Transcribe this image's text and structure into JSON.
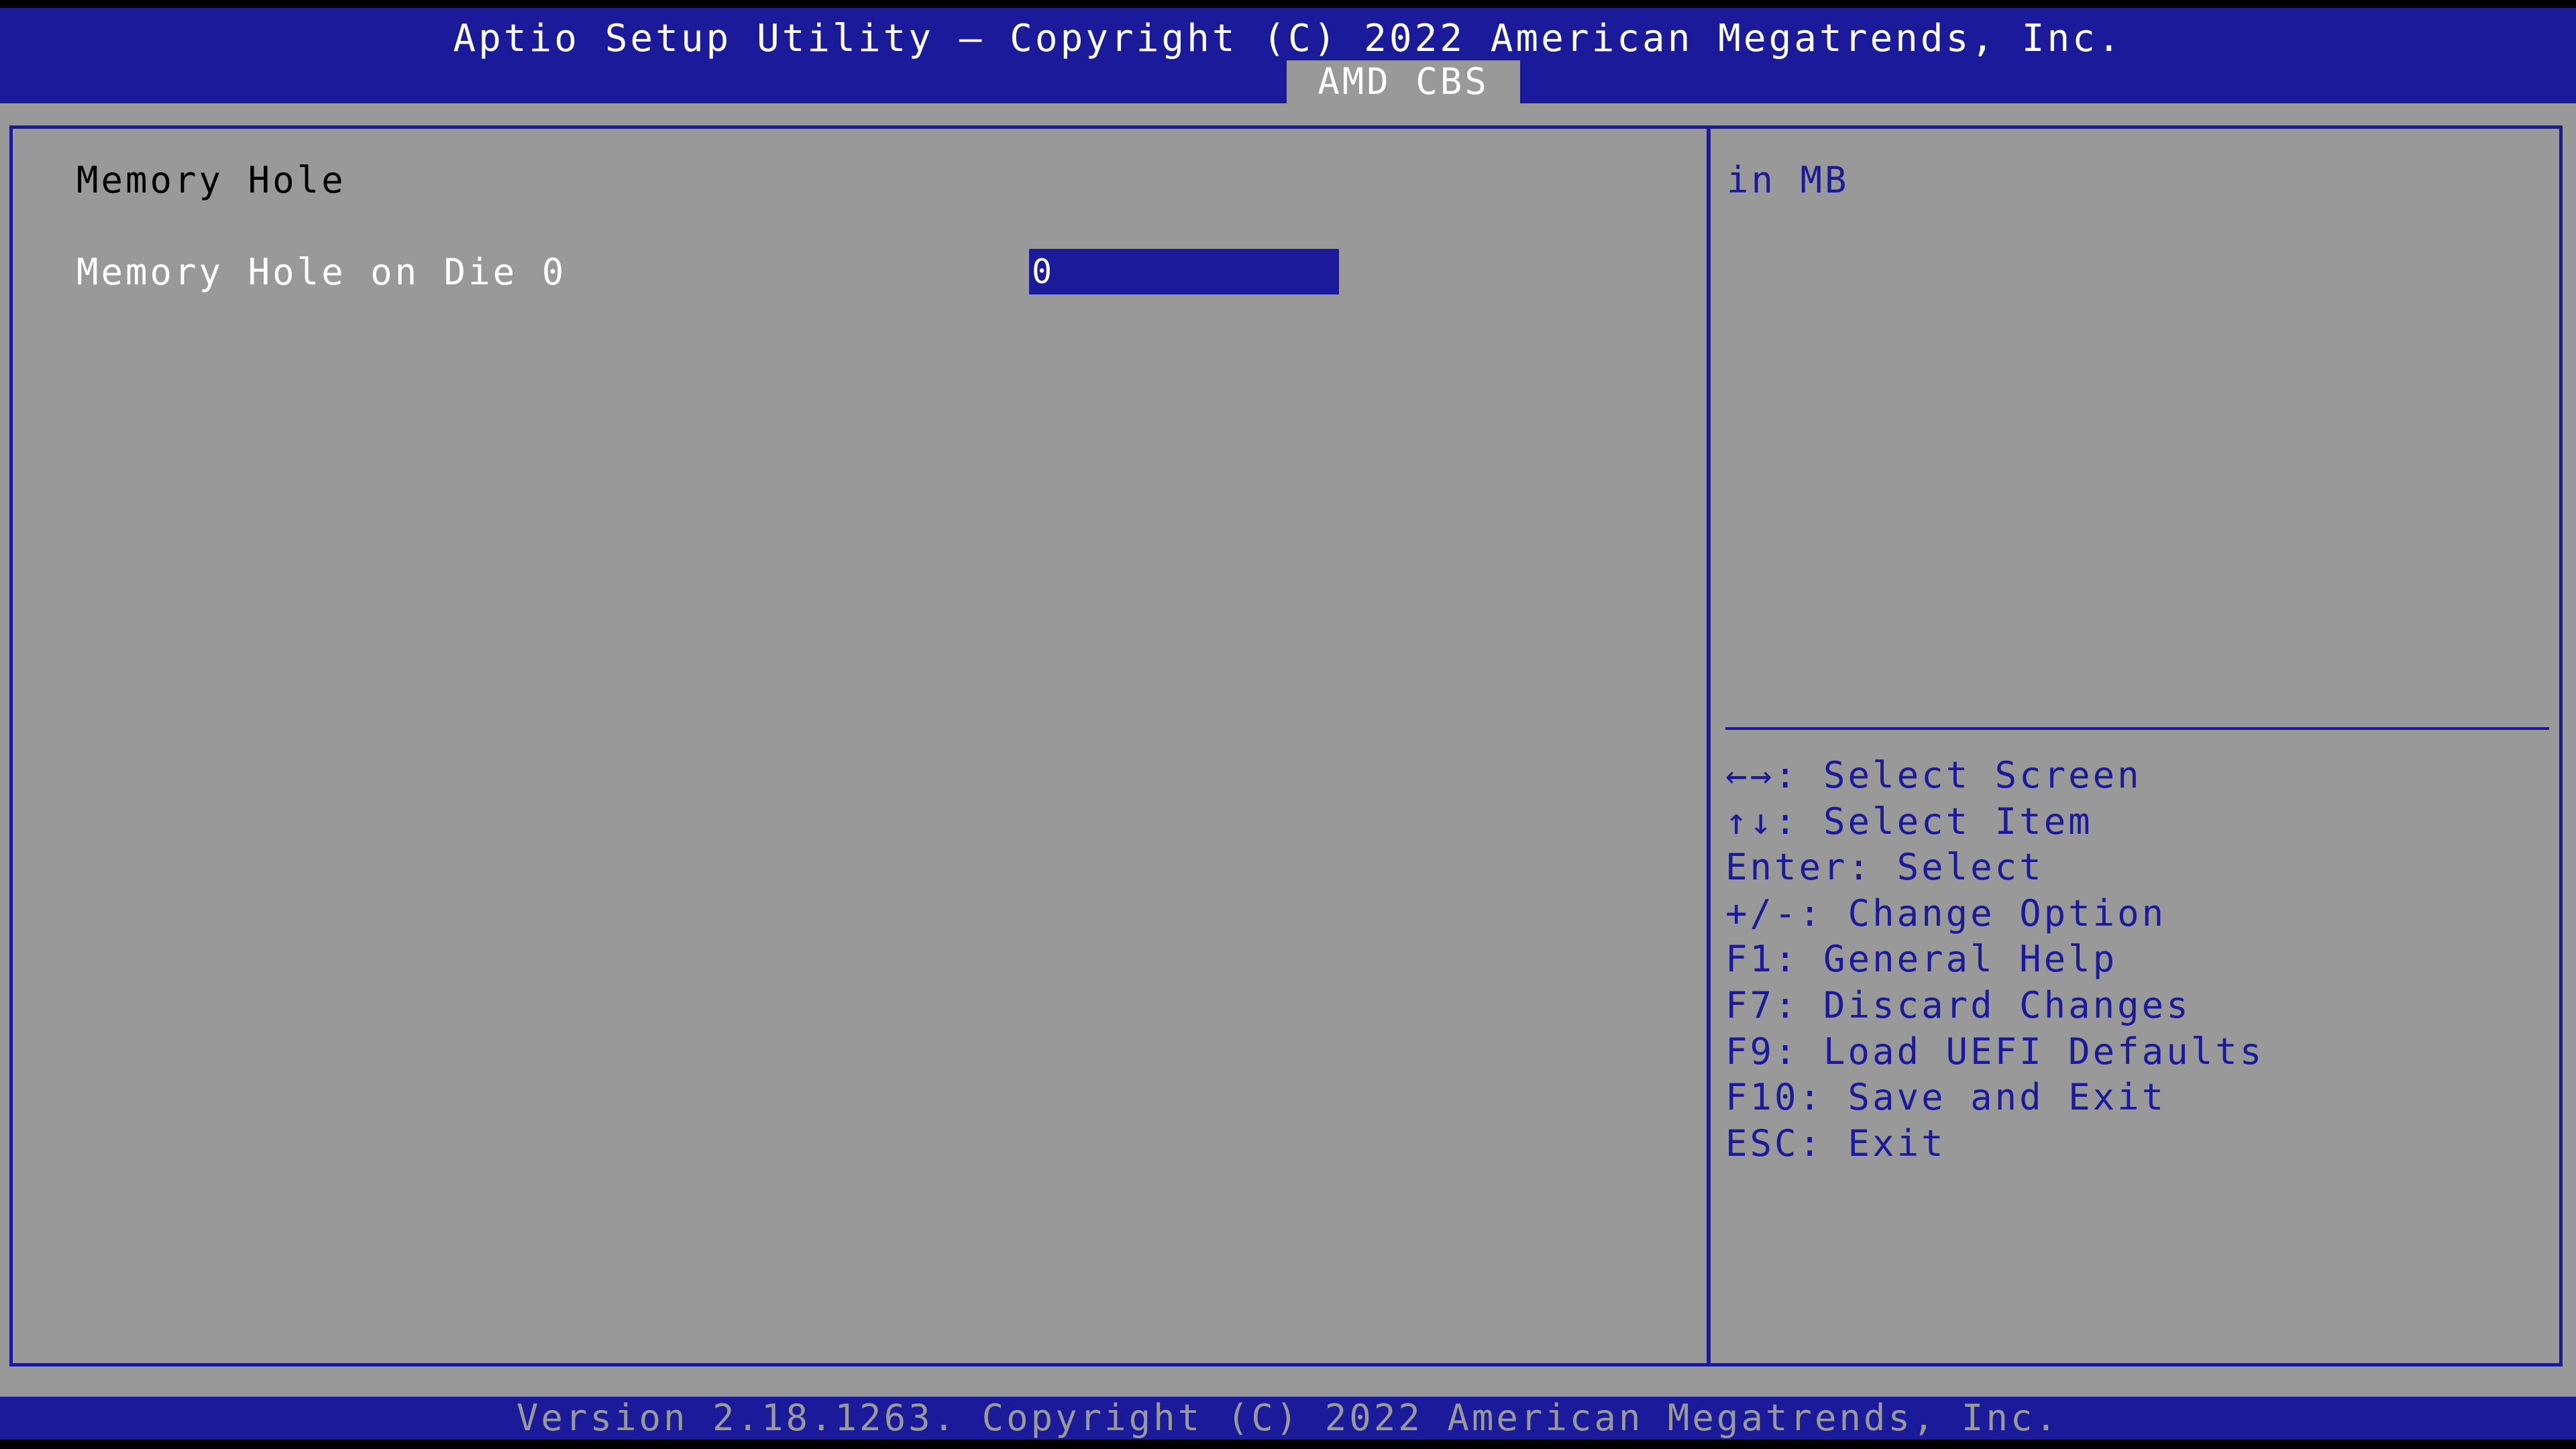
{
  "header": {
    "title": "Aptio Setup Utility – Copyright (C) 2022 American Megatrends, Inc.",
    "active_tab": "AMD CBS"
  },
  "main": {
    "section_title": "Memory Hole",
    "items": [
      {
        "label": "Memory Hole on Die 0",
        "value": "0"
      }
    ]
  },
  "help": {
    "description": "in MB",
    "keys": [
      "←→: Select Screen",
      "↑↓: Select Item",
      "Enter: Select",
      "+/-: Change Option",
      "F1: General Help",
      "F7: Discard Changes",
      "F9: Load UEFI Defaults",
      "F10: Save and Exit",
      "ESC: Exit"
    ]
  },
  "footer": {
    "text": "Version 2.18.1263. Copyright (C) 2022 American Megatrends, Inc."
  },
  "colors": {
    "bios_blue": "#1a1a9a",
    "bios_gray": "#999999",
    "text_white": "#ffffff",
    "text_black": "#000000"
  }
}
